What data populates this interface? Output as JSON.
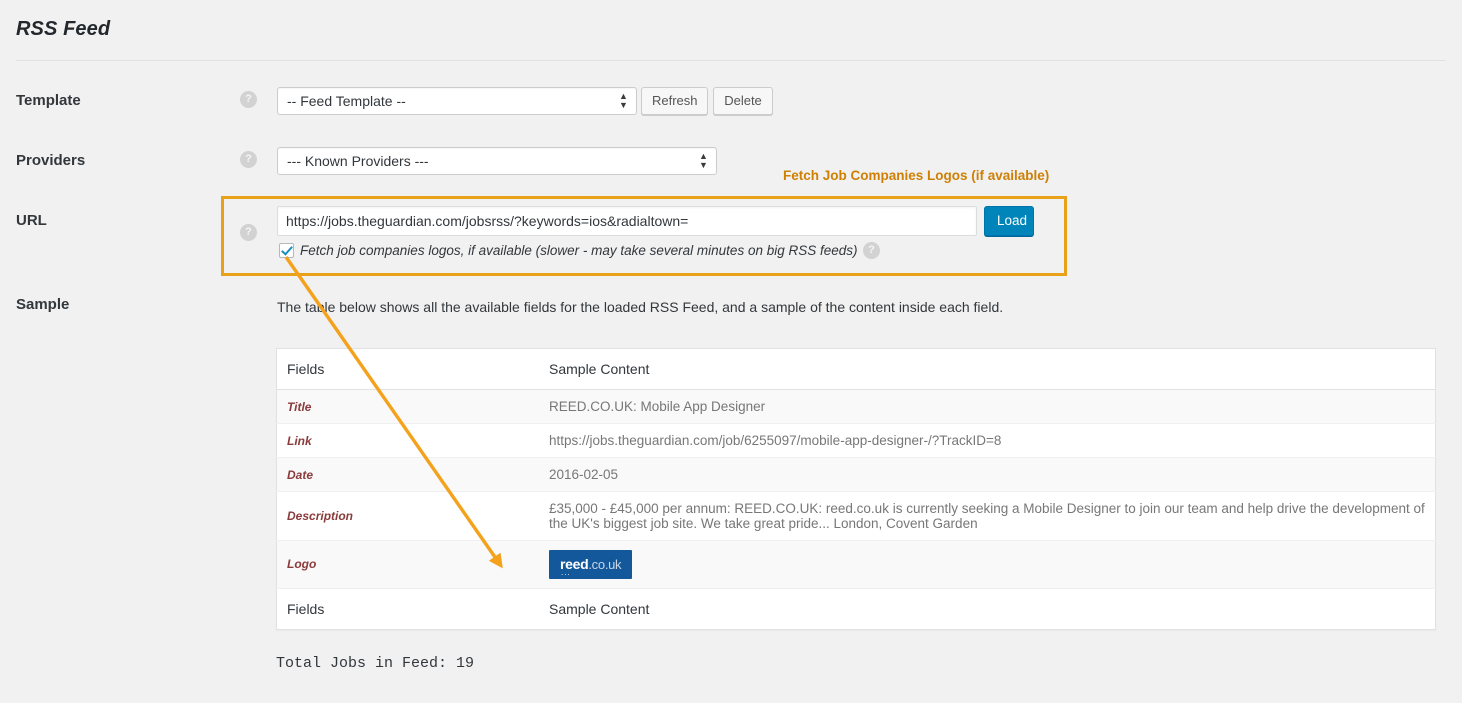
{
  "page": {
    "title": "RSS Feed"
  },
  "form": {
    "template": {
      "label": "Template",
      "help": "?",
      "select_value": "-- Feed Template --",
      "refresh_label": "Refresh",
      "delete_label": "Delete"
    },
    "providers": {
      "label": "Providers",
      "help": "?",
      "select_value": "--- Known Providers ---"
    },
    "url": {
      "label": "URL",
      "help": "?",
      "value": "https://jobs.theguardian.com/jobsrss/?keywords=ios&radialtown=",
      "placeholder": "https://jobs.theguardian.com/jobsrss/?keywords=ios&radialtown=",
      "load_label": "Load",
      "checkbox_label": "Fetch job companies logos, if available (slower - may take several minutes on big RSS feeds)",
      "checkbox_checked": true,
      "checkbox_help": "?"
    },
    "sample": {
      "label": "Sample",
      "description": "The table below shows all the available fields for the loaded RSS Feed, and a sample of the content inside each field."
    }
  },
  "annotation": {
    "callout_text": "Fetch Job Companies Logos (if available)",
    "box_color": "#e8a219",
    "text_color": "#cf8004"
  },
  "table": {
    "headers": {
      "field": "Fields",
      "content": "Sample Content"
    },
    "footers": {
      "field": "Fields",
      "content": "Sample Content"
    },
    "rows": [
      {
        "field": "Title",
        "content": "REED.CO.UK: Mobile App Designer"
      },
      {
        "field": "Link",
        "content": "https://jobs.theguardian.com/job/6255097/mobile-app-designer-/?TrackID=8"
      },
      {
        "field": "Date",
        "content": "2016-02-05"
      },
      {
        "field": "Description",
        "content": "£35,000 - £45,000 per annum: REED.CO.UK: reed.co.uk is currently seeking a Mobile Designer to join our team and help drive the development of the UK's biggest job site. We take great pride... London, Covent Garden"
      },
      {
        "field": "Logo",
        "content": ""
      }
    ],
    "logo": {
      "brand": "reed",
      "tld": ".co.uk",
      "dots": "...",
      "background": "#14589c"
    }
  },
  "footer": {
    "total_jobs": "Total Jobs in Feed: 19"
  },
  "colors": {
    "primary_button": "#0085ba",
    "accent_orange": "#e8a219",
    "field_label": "#8a3b3b"
  }
}
